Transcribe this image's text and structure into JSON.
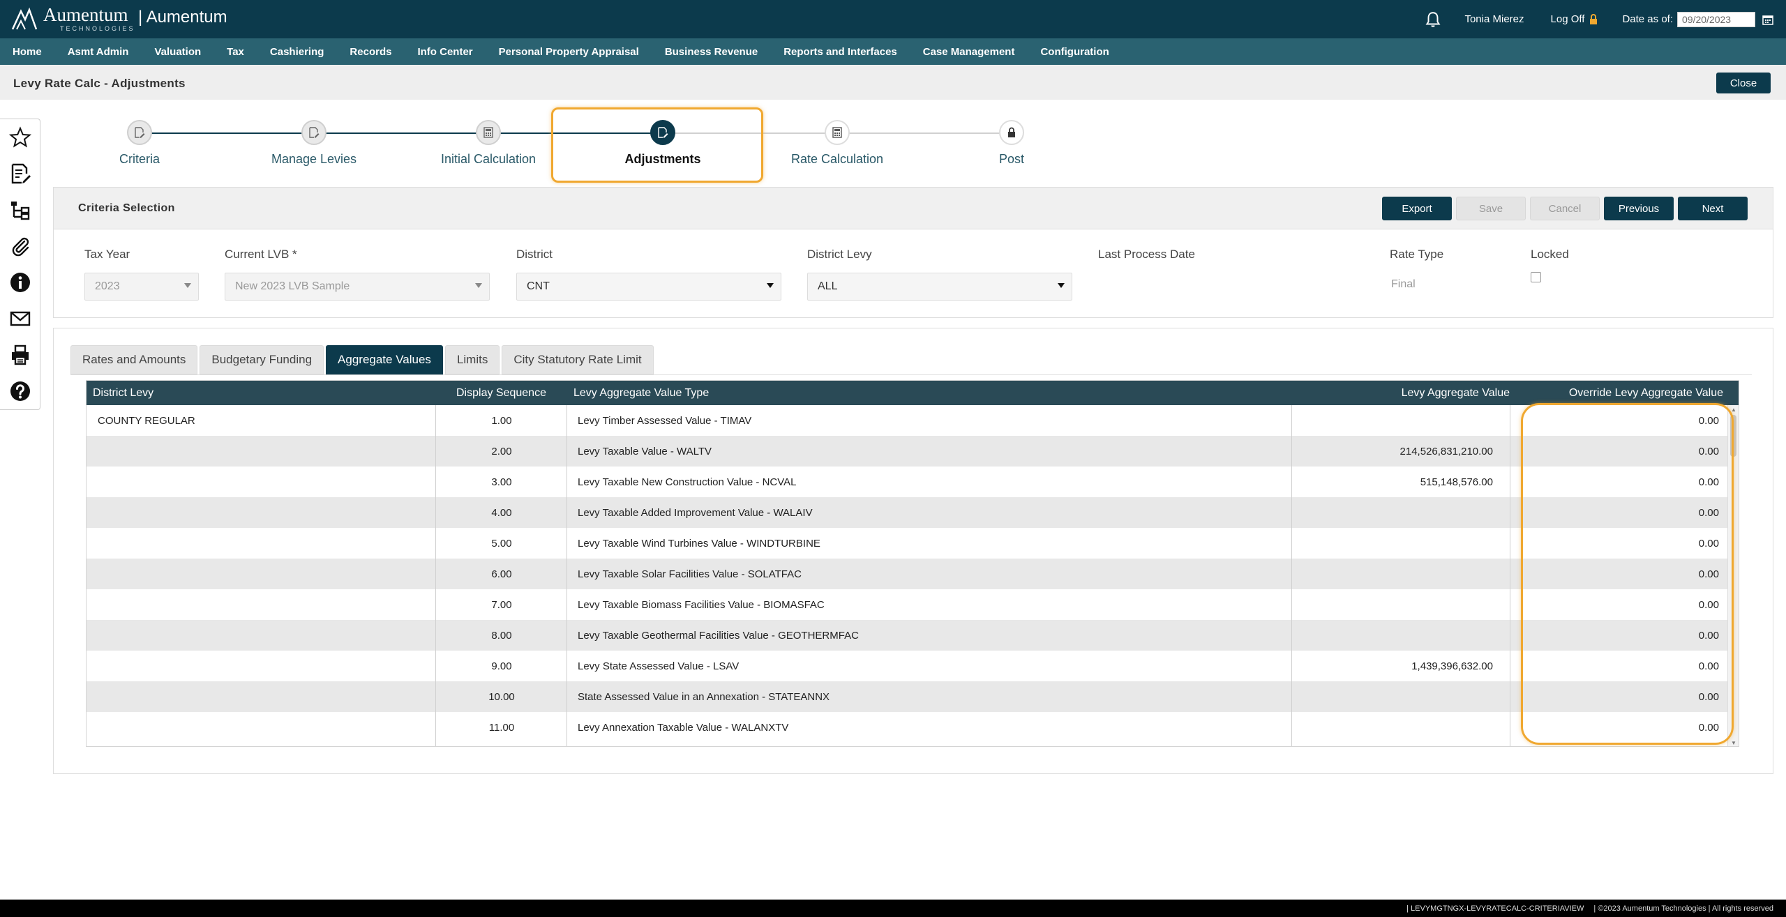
{
  "header": {
    "logo_word": "Aumentum",
    "logo_sub": "TECHNOLOGIES",
    "brand": "| Aumentum",
    "username": "Tonia Mierez",
    "logoff_label": "Log Off",
    "date_label": "Date as of:",
    "date_value": "09/20/2023",
    "icons": [
      "bell-icon",
      "lock-icon",
      "calendar-icon"
    ]
  },
  "nav": {
    "items": [
      "Home",
      "Asmt Admin",
      "Valuation",
      "Tax",
      "Cashiering",
      "Records",
      "Info Center",
      "Personal Property Appraisal",
      "Business Revenue",
      "Reports and Interfaces",
      "Case Management",
      "Configuration"
    ]
  },
  "page": {
    "title": "Levy Rate Calc - Adjustments",
    "close_label": "Close"
  },
  "left_tools": [
    "star-icon",
    "edit-document-icon",
    "hierarchy-icon",
    "paperclip-icon",
    "info-icon",
    "mail-icon",
    "printer-icon",
    "help-icon"
  ],
  "wizard": {
    "steps": [
      {
        "label": "Criteria",
        "icon": "edit-icon",
        "done": true
      },
      {
        "label": "Manage Levies",
        "icon": "edit-icon",
        "done": true
      },
      {
        "label": "Initial Calculation",
        "icon": "calculator-icon",
        "done": true
      },
      {
        "label": "Adjustments",
        "icon": "edit-icon",
        "active": true
      },
      {
        "label": "Rate Calculation",
        "icon": "calculator-icon",
        "done": false
      },
      {
        "label": "Post",
        "icon": "lock-icon",
        "done": false
      }
    ],
    "colors": {
      "done_line": "#0c3a4c",
      "pending_line": "#d0d0d0",
      "highlight": "#f0a830"
    }
  },
  "criteria": {
    "title": "Criteria Selection",
    "buttons": {
      "export": "Export",
      "save": "Save",
      "cancel": "Cancel",
      "previous": "Previous",
      "next": "Next"
    },
    "tax_year": {
      "label": "Tax Year",
      "value": "2023"
    },
    "current_lvb": {
      "label": "Current LVB *",
      "value": "New 2023 LVB Sample"
    },
    "district": {
      "label": "District",
      "value": "CNT"
    },
    "district_levy": {
      "label": "District Levy",
      "value": "ALL"
    },
    "last_process_date": {
      "label": "Last Process Date",
      "value": ""
    },
    "rate_type": {
      "label": "Rate Type",
      "value": "Final"
    },
    "locked": {
      "label": "Locked",
      "checked": false
    }
  },
  "tabs": [
    {
      "label": "Rates and Amounts",
      "active": false
    },
    {
      "label": "Budgetary Funding",
      "active": false
    },
    {
      "label": "Aggregate Values",
      "active": true
    },
    {
      "label": "Limits",
      "active": false
    },
    {
      "label": "City Statutory Rate Limit",
      "active": false
    }
  ],
  "grid": {
    "columns": [
      "District Levy",
      "Display Sequence",
      "Levy Aggregate Value Type",
      "Levy Aggregate Value",
      "Override Levy Aggregate Value"
    ],
    "rows": [
      {
        "district_levy": "COUNTY REGULAR",
        "seq": "1.00",
        "type": "Levy Timber Assessed Value - TIMAV",
        "value": "",
        "override": "0.00"
      },
      {
        "district_levy": "",
        "seq": "2.00",
        "type": "Levy Taxable Value - WALTV",
        "value": "214,526,831,210.00",
        "override": "0.00"
      },
      {
        "district_levy": "",
        "seq": "3.00",
        "type": "Levy Taxable New Construction Value - NCVAL",
        "value": "515,148,576.00",
        "override": "0.00"
      },
      {
        "district_levy": "",
        "seq": "4.00",
        "type": "Levy Taxable Added Improvement Value - WALAIV",
        "value": "",
        "override": "0.00"
      },
      {
        "district_levy": "",
        "seq": "5.00",
        "type": "Levy Taxable Wind Turbines Value - WINDTURBINE",
        "value": "",
        "override": "0.00"
      },
      {
        "district_levy": "",
        "seq": "6.00",
        "type": "Levy Taxable Solar Facilities Value - SOLATFAC",
        "value": "",
        "override": "0.00"
      },
      {
        "district_levy": "",
        "seq": "7.00",
        "type": "Levy Taxable Biomass Facilities Value - BIOMASFAC",
        "value": "",
        "override": "0.00"
      },
      {
        "district_levy": "",
        "seq": "8.00",
        "type": "Levy Taxable Geothermal Facilities Value - GEOTHERMFAC",
        "value": "",
        "override": "0.00"
      },
      {
        "district_levy": "",
        "seq": "9.00",
        "type": "Levy State Assessed Value - LSAV",
        "value": "1,439,396,632.00",
        "override": "0.00"
      },
      {
        "district_levy": "",
        "seq": "10.00",
        "type": "State Assessed Value in an Annexation - STATEANNX",
        "value": "",
        "override": "0.00"
      },
      {
        "district_levy": "",
        "seq": "11.00",
        "type": "Levy Annexation Taxable Value - WALANXTV",
        "value": "",
        "override": "0.00"
      }
    ]
  },
  "footer": {
    "view_id": "|  LEVYMGTNGX-LEVYRATECALC-CRITERIAVIEW",
    "copyright": "|  ©2023 Aumentum Technologies | All rights reserved"
  },
  "colors": {
    "primary": "#0c3a4c",
    "nav": "#2a6271",
    "highlight": "#f0a830"
  }
}
